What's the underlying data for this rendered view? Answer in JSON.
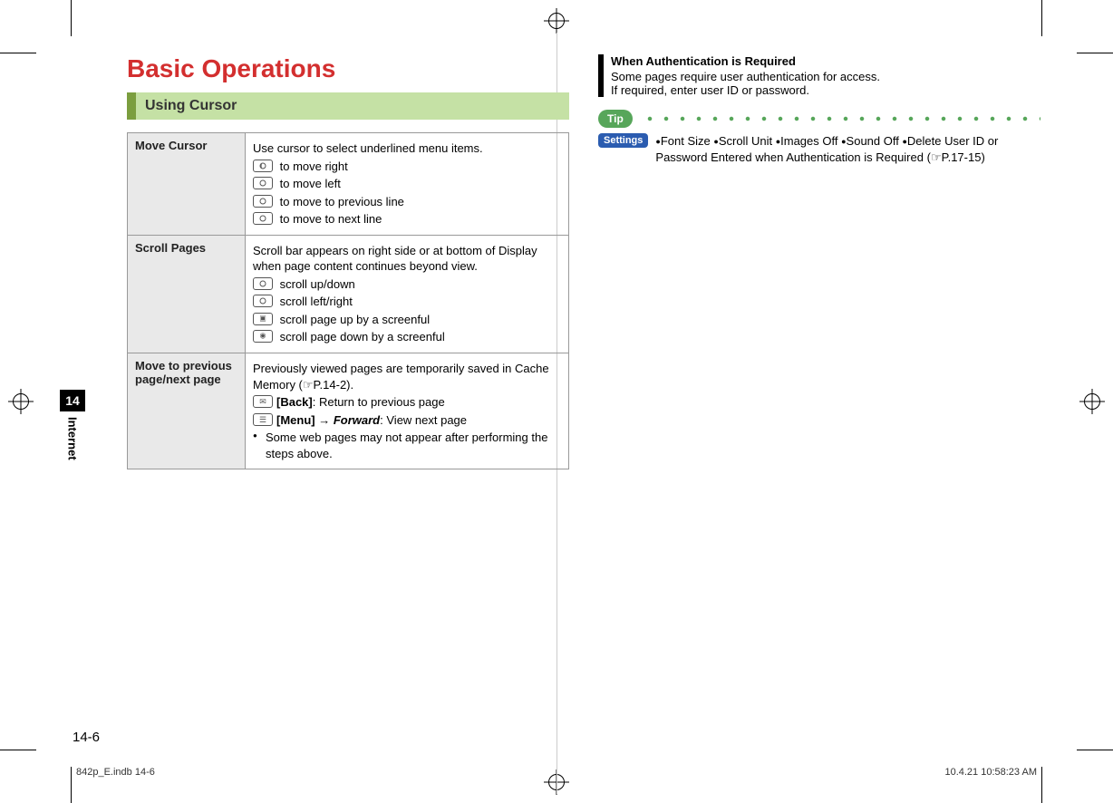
{
  "header": {
    "title": "Basic Operations"
  },
  "section": {
    "heading": "Using Cursor"
  },
  "side": {
    "chapter_num": "14",
    "chapter_name": "Internet",
    "page_num": "14-6"
  },
  "table": {
    "rows": [
      {
        "label": "Move Cursor",
        "intro": "Use cursor to select underlined menu items.",
        "items": [
          {
            "icon": "right-arrow",
            "text": " to move right"
          },
          {
            "icon": "left-arrow",
            "text": " to move left"
          },
          {
            "icon": "up-arrow",
            "text": " to move to previous line"
          },
          {
            "icon": "down-arrow",
            "text": " to move to next line"
          }
        ]
      },
      {
        "label": "Scroll Pages",
        "intro": "Scroll bar appears on right side or at bottom of Display when page content continues beyond view.",
        "items": [
          {
            "icon": "up-arrow",
            "text": " scroll up/down"
          },
          {
            "icon": "left-arrow",
            "text": " scroll left/right"
          },
          {
            "icon": "cam",
            "text": " scroll page up by a screenful"
          },
          {
            "icon": "pic",
            "text": " scroll page down by a screenful"
          }
        ]
      },
      {
        "label": "Move to previous page/next page",
        "intro": "Previously viewed pages are temporarily saved in Cache Memory (☞P.14-2).",
        "lines": [
          {
            "icon": "mail",
            "bold": "[Back]",
            "rest": ": Return to previous page"
          },
          {
            "icon": "menu",
            "bold": "[Menu]",
            "arrow": " → ",
            "italic": "Forward",
            "rest2": ": View next page"
          }
        ],
        "note": "Some web pages may not appear after performing the steps above."
      }
    ]
  },
  "auth": {
    "title": "When Authentication is Required",
    "line1": "Some pages require user authentication for access.",
    "line2": "If required, enter user ID or password."
  },
  "tip": {
    "label": "Tip"
  },
  "settings": {
    "label": "Settings",
    "items": [
      "Font Size",
      "Scroll Unit",
      "Images Off",
      "Sound Off",
      "Delete User ID or Password Entered when Authentication is Required"
    ],
    "ref": "(☞P.17-15)"
  },
  "footer": {
    "left": "842p_E.indb   14-6",
    "right": "10.4.21   10:58:23 AM"
  }
}
